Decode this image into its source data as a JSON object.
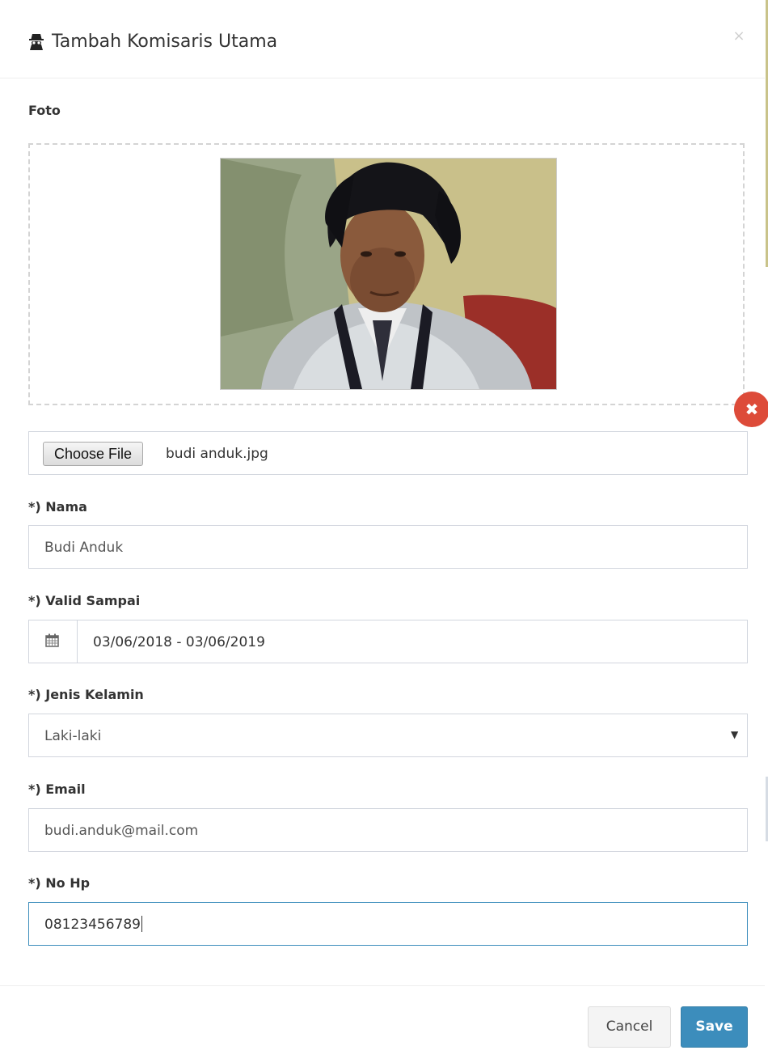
{
  "modal": {
    "title": "Tambah Komisaris Utama",
    "icon": "user-secret-icon",
    "close_symbol": "×"
  },
  "photo": {
    "label": "Foto",
    "remove_symbol": "✖",
    "image_description_icon": "portrait-photo"
  },
  "file": {
    "button_label": "Choose File",
    "file_name": "budi anduk.jpg"
  },
  "fields": {
    "nama": {
      "label": "*) Nama",
      "value": "Budi Anduk"
    },
    "valid_sampai": {
      "label": "*) Valid Sampai",
      "value": "03/06/2018 - 03/06/2019",
      "icon": "calendar-icon"
    },
    "jenis_kelamin": {
      "label": "*) Jenis Kelamin",
      "value": "Laki-laki",
      "caret": "▼"
    },
    "email": {
      "label": "*) Email",
      "value": "budi.anduk@mail.com"
    },
    "no_hp": {
      "label": "*) No Hp",
      "value": "08123456789"
    }
  },
  "footer": {
    "cancel_label": "Cancel",
    "save_label": "Save"
  },
  "colors": {
    "primary": "#3c8dbc",
    "danger": "#dd4b39",
    "border": "#d2d6de"
  }
}
